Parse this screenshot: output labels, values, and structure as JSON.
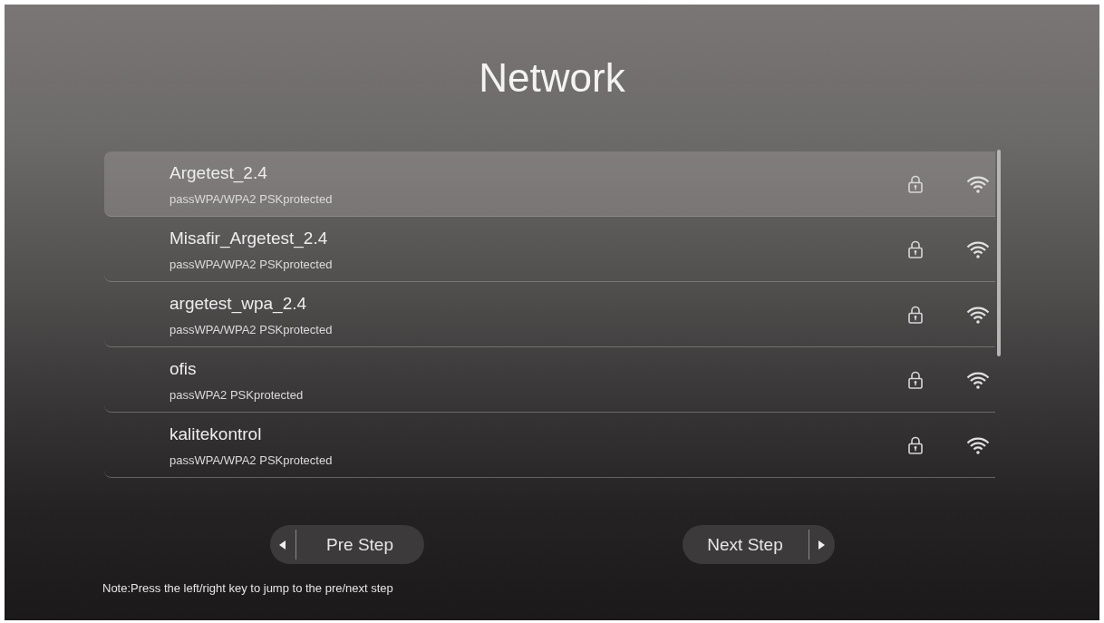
{
  "title": "Network",
  "networks": [
    {
      "name": "Argetest_2.4",
      "security": "passWPA/WPA2 PSKprotected",
      "selected": true,
      "secured": true
    },
    {
      "name": "Misafir_Argetest_2.4",
      "security": "passWPA/WPA2 PSKprotected",
      "selected": false,
      "secured": true
    },
    {
      "name": "argetest_wpa_2.4",
      "security": "passWPA/WPA2 PSKprotected",
      "selected": false,
      "secured": true
    },
    {
      "name": "ofis",
      "security": "passWPA2 PSKprotected",
      "selected": false,
      "secured": true
    },
    {
      "name": "kalitekontrol",
      "security": "passWPA/WPA2 PSKprotected",
      "selected": false,
      "secured": true
    }
  ],
  "buttons": [
    {
      "kind": "prev",
      "label": "Pre Step"
    },
    {
      "kind": "next",
      "label": "Next Step"
    }
  ],
  "note": "Note:Press the left/right key to jump to the pre/next step"
}
